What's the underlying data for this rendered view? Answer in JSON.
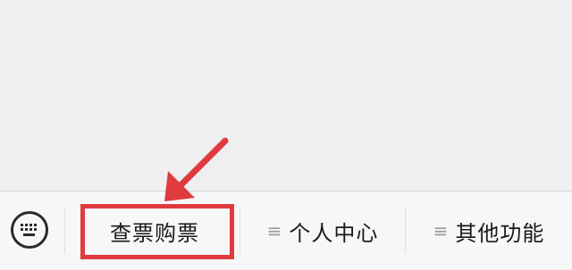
{
  "menu": {
    "items": [
      {
        "label": "查票购票",
        "has_submenu_icon": false
      },
      {
        "label": "个人中心",
        "has_submenu_icon": true,
        "submenu_icon": "≡"
      },
      {
        "label": "其他功能",
        "has_submenu_icon": true,
        "submenu_icon": "≡"
      }
    ],
    "keyboard_icon": "keyboard-icon"
  },
  "annotation": {
    "highlight_color": "#e03a3e",
    "target": "查票购票"
  }
}
